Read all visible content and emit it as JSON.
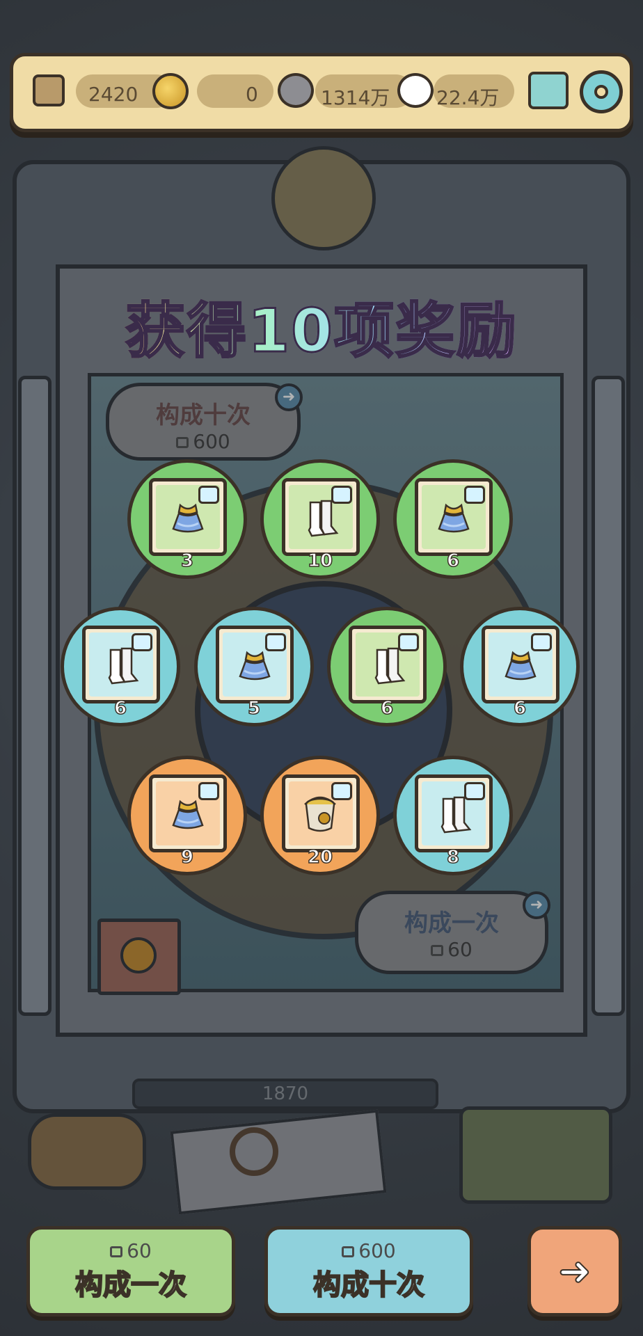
{
  "topbar": {
    "tickets": "2420",
    "coins": "0",
    "grey_bubbles": "1314万",
    "white_bubbles": "22.4万"
  },
  "title": "获得10项奖励",
  "scene": {
    "ten_tag": {
      "label": "构成十次",
      "cost": "600"
    },
    "one_tag": {
      "label": "构成一次",
      "cost": "60"
    },
    "year_text": "1870"
  },
  "rewards": [
    {
      "item": "skirt",
      "count": "3",
      "bg": "#7ccd73"
    },
    {
      "item": "boots",
      "count": "10",
      "bg": "#7ccd73"
    },
    {
      "item": "skirt",
      "count": "6",
      "bg": "#7ccd73"
    },
    {
      "item": "boots",
      "count": "6",
      "bg": "#7fd1d8"
    },
    {
      "item": "skirt",
      "count": "5",
      "bg": "#7fd1d8"
    },
    {
      "item": "boots",
      "count": "6",
      "bg": "#7ccd73"
    },
    {
      "item": "skirt",
      "count": "6",
      "bg": "#7fd1d8"
    },
    {
      "item": "skirt",
      "count": "9",
      "bg": "#f2a45a"
    },
    {
      "item": "bucket",
      "count": "20",
      "bg": "#f2a45a"
    },
    {
      "item": "boots",
      "count": "8",
      "bg": "#7fd1d8"
    }
  ],
  "buttons": {
    "once": {
      "cost": "60",
      "label": "构成一次"
    },
    "ten": {
      "cost": "600",
      "label": "构成十次"
    }
  }
}
